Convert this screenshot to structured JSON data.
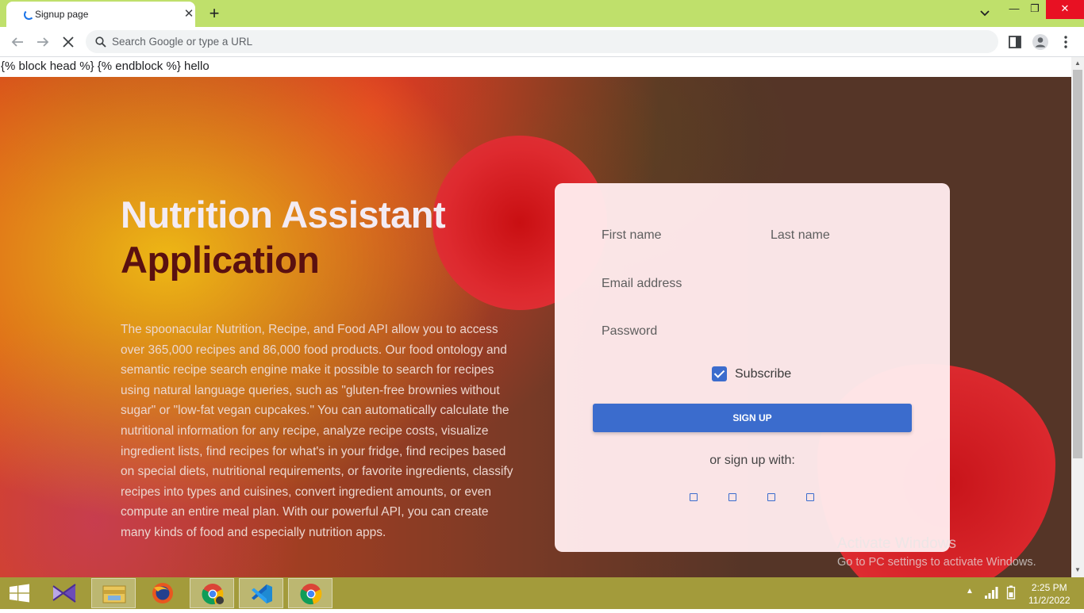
{
  "browser": {
    "tab_title": "Signup page",
    "tab_close": "✕",
    "new_tab": "+",
    "omnibox_placeholder": "Search Google or type a URL",
    "window_controls": {
      "minimize": "—",
      "restore": "❐",
      "close": "✕"
    }
  },
  "page": {
    "raw_template_text": "{% block head %} {% endblock %} hello",
    "headline_line1": "Nutrition Assistant",
    "headline_line2": "Application",
    "description": "The spoonacular Nutrition, Recipe, and Food API allow you to access over 365,000 recipes and 86,000 food products. Our food ontology and semantic recipe search engine make it possible to search for recipes using natural language queries, such as \"gluten-free brownies without sugar\" or \"low-fat vegan cupcakes.\" You can automatically calculate the nutritional information for any recipe, analyze recipe costs, visualize ingredient lists, find recipes for what's in your fridge, find recipes based on special diets, nutritional requirements, or favorite ingredients, classify recipes into types and cuisines, convert ingredient amounts, or even compute an entire meal plan. With our powerful API, you can create many kinds of food and especially nutrition apps."
  },
  "form": {
    "first_name_label": "First name",
    "last_name_label": "Last name",
    "email_label": "Email address",
    "password_label": "Password",
    "subscribe_label": "Subscribe",
    "subscribe_checked": true,
    "signup_button": "SIGN UP",
    "or_text": "or sign up with:",
    "social_buttons": [
      "facebook-icon",
      "google-icon",
      "twitter-icon",
      "github-icon"
    ]
  },
  "watermark": {
    "title": "Activate Windows",
    "subtitle": "Go to PC settings to activate Windows."
  },
  "taskbar": {
    "apps": [
      "start-icon",
      "visual-studio-icon",
      "file-explorer-icon",
      "firefox-icon",
      "chrome-canary-icon",
      "vscode-icon",
      "chrome-icon"
    ],
    "time": "2:25 PM",
    "date": "11/2/2022"
  },
  "colors": {
    "accent_blue": "#3b6ccd",
    "tabstrip": "#bfe06b",
    "taskbar": "#a39b3b",
    "headline_dark": "#5a1010"
  }
}
